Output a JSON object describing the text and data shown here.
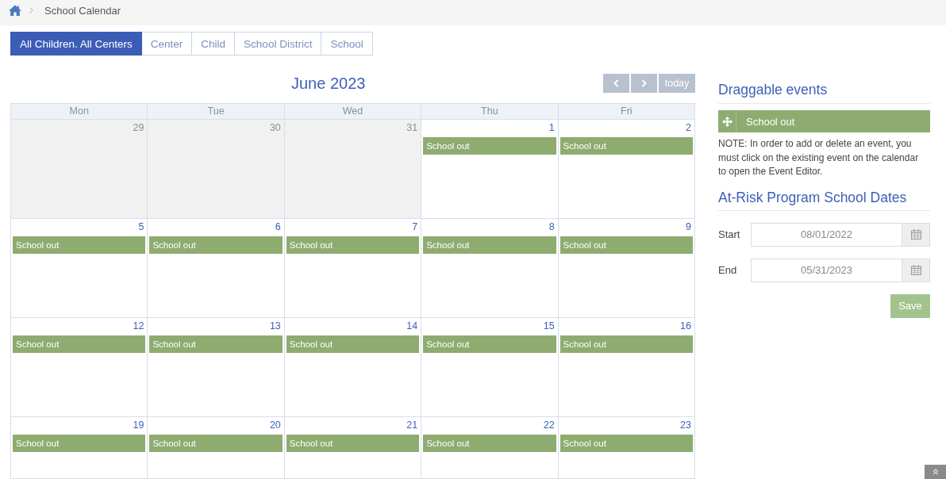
{
  "breadcrumb": {
    "current": "School Calendar"
  },
  "tabs": [
    {
      "label": "All Children. All Centers",
      "selected": true
    },
    {
      "label": "Center",
      "selected": false
    },
    {
      "label": "Child",
      "selected": false
    },
    {
      "label": "School District",
      "selected": false
    },
    {
      "label": "School",
      "selected": false
    }
  ],
  "calendar": {
    "title": "June 2023",
    "today_button": "today",
    "weekdays": [
      "Mon",
      "Tue",
      "Wed",
      "Thu",
      "Fri"
    ],
    "weeks": [
      {
        "days": [
          {
            "number": "29",
            "other_month": true
          },
          {
            "number": "30",
            "other_month": true
          },
          {
            "number": "31",
            "other_month": true
          },
          {
            "number": "1",
            "other_month": false,
            "events": [
              {
                "label": "School out"
              }
            ]
          },
          {
            "number": "2",
            "other_month": false,
            "events": [
              {
                "label": "School out"
              }
            ]
          }
        ]
      },
      {
        "days": [
          {
            "number": "5",
            "other_month": false,
            "events": [
              {
                "label": "School out"
              }
            ]
          },
          {
            "number": "6",
            "other_month": false,
            "events": [
              {
                "label": "School out"
              }
            ]
          },
          {
            "number": "7",
            "other_month": false,
            "events": [
              {
                "label": "School out"
              }
            ]
          },
          {
            "number": "8",
            "other_month": false,
            "events": [
              {
                "label": "School out"
              }
            ]
          },
          {
            "number": "9",
            "other_month": false,
            "events": [
              {
                "label": "School out"
              }
            ]
          }
        ]
      },
      {
        "days": [
          {
            "number": "12",
            "other_month": false,
            "events": [
              {
                "label": "School out"
              }
            ]
          },
          {
            "number": "13",
            "other_month": false,
            "events": [
              {
                "label": "School out"
              }
            ]
          },
          {
            "number": "14",
            "other_month": false,
            "events": [
              {
                "label": "School out"
              }
            ]
          },
          {
            "number": "15",
            "other_month": false,
            "events": [
              {
                "label": "School out"
              }
            ]
          },
          {
            "number": "16",
            "other_month": false,
            "events": [
              {
                "label": "School out"
              }
            ]
          }
        ]
      },
      {
        "days": [
          {
            "number": "19",
            "other_month": false,
            "events": [
              {
                "label": "School out"
              }
            ]
          },
          {
            "number": "20",
            "other_month": false,
            "events": [
              {
                "label": "School out"
              }
            ]
          },
          {
            "number": "21",
            "other_month": false,
            "events": [
              {
                "label": "School out"
              }
            ]
          },
          {
            "number": "22",
            "other_month": false,
            "events": [
              {
                "label": "School out"
              }
            ]
          },
          {
            "number": "23",
            "other_month": false,
            "events": [
              {
                "label": "School out"
              }
            ]
          }
        ]
      }
    ]
  },
  "sidebar": {
    "draggable_title": "Draggable events",
    "draggable_events": [
      {
        "label": "School out"
      }
    ],
    "note": "NOTE: In order to add or delete an event, you must click on the existing event on the calendar to open the Event Editor.",
    "dates_title": "At-Risk Program School Dates",
    "fields": [
      {
        "label": "Start",
        "value": "08/01/2022"
      },
      {
        "label": "End",
        "value": "05/31/2023"
      }
    ],
    "save_button": {
      "label": "Save",
      "disabled": true
    }
  }
}
